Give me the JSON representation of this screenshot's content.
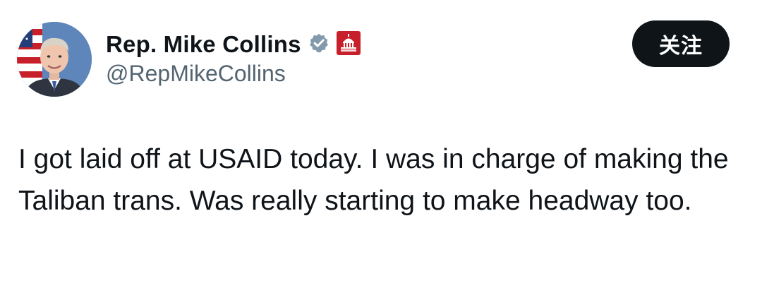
{
  "author": {
    "display_name": "Rep. Mike Collins",
    "handle": "@RepMikeCollins",
    "verified_icon": "verified-badge-icon",
    "affiliation_icon": "us-capitol-icon",
    "colors": {
      "verified_badge": "#829aab",
      "affiliation_badge": "#c8202a"
    }
  },
  "follow_button": {
    "label": "关注",
    "color": "#0f1419"
  },
  "tweet": {
    "text": "I got laid off at USAID today. I was in charge of making the Taliban trans. Was really starting to make headway too."
  }
}
